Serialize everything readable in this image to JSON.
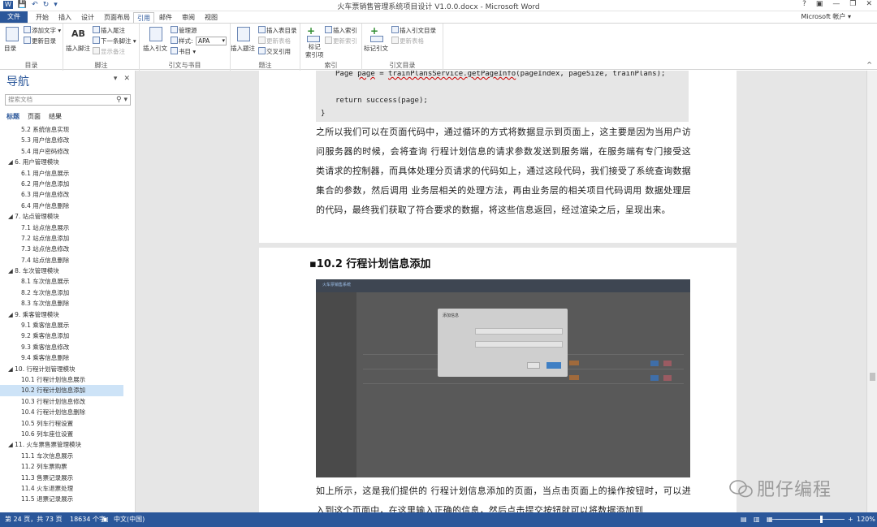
{
  "window": {
    "title": "火车票销售管理系统项目设计 V1.0.0.docx - Microsoft Word",
    "help": "?",
    "account": "Microsoft 帐户"
  },
  "qat": {
    "save": "💾",
    "undo": "↶",
    "redo": "↻",
    "customize": "▾"
  },
  "ribbon_tabs": [
    "开始",
    "插入",
    "设计",
    "页面布局",
    "引用",
    "邮件",
    "审阅",
    "视图"
  ],
  "file_tab": "文件",
  "active_tab": "引用",
  "ribbon": {
    "toc": {
      "big": "目录",
      "add_text": "添加文字",
      "update": "更新目录",
      "group": "目录"
    },
    "footnotes": {
      "insert_footnote": "插入脚注",
      "insert_endnote": "插入尾注",
      "next": "下一条脚注",
      "show": "显示备注",
      "group": "脚注",
      "ab": "AB"
    },
    "citations": {
      "insert": "插入引文",
      "manage": "管理源",
      "style_label": "样式:",
      "style_value": "APA",
      "bib": "书目",
      "group": "引文与书目"
    },
    "captions": {
      "insert_caption": "插入题注",
      "insert_tof": "插入表目录",
      "update_table": "更新表格",
      "cross_ref": "交叉引用",
      "group": "题注"
    },
    "index": {
      "mark": "标记\n索引项",
      "insert_index": "插入索引",
      "update_index": "更新索引",
      "group": "索引"
    },
    "toa": {
      "mark": "标记引文",
      "insert_toa": "插入引文目录",
      "update_table": "更新表格",
      "group": "引文目录"
    }
  },
  "nav": {
    "title": "导航",
    "search_placeholder": "搜索文档",
    "tabs": [
      "标题",
      "页面",
      "结果"
    ],
    "items": [
      {
        "text": "5.2 系统信息实现",
        "level": 2
      },
      {
        "text": "5.3 用户信息修改",
        "level": 2
      },
      {
        "text": "5.4 用户密码修改",
        "level": 2
      },
      {
        "text": "◢ 6. 用户管理模块",
        "level": 1
      },
      {
        "text": "6.1 用户信息展示",
        "level": 2
      },
      {
        "text": "6.2 用户信息添加",
        "level": 2
      },
      {
        "text": "6.3 用户信息修改",
        "level": 2
      },
      {
        "text": "6.4 用户信息删除",
        "level": 2
      },
      {
        "text": "◢ 7. 站点管理模块",
        "level": 1
      },
      {
        "text": "7.1 站点信息展示",
        "level": 2
      },
      {
        "text": "7.2 站点信息添加",
        "level": 2
      },
      {
        "text": "7.3 站点信息修改",
        "level": 2
      },
      {
        "text": "7.4 站点信息删除",
        "level": 2
      },
      {
        "text": "◢ 8. 车次管理模块",
        "level": 1
      },
      {
        "text": "8.1 车次信息展示",
        "level": 2
      },
      {
        "text": "8.2 车次信息添加",
        "level": 2
      },
      {
        "text": "8.3 车次信息删除",
        "level": 2
      },
      {
        "text": "◢ 9. 乘客管理模块",
        "level": 1
      },
      {
        "text": "9.1 乘客信息展示",
        "level": 2
      },
      {
        "text": "9.2 乘客信息添加",
        "level": 2
      },
      {
        "text": "9.3 乘客信息修改",
        "level": 2
      },
      {
        "text": "9.4 乘客信息删除",
        "level": 2
      },
      {
        "text": "◢ 10. 行程计划管理模块",
        "level": 1
      },
      {
        "text": "10.1 行程计划信息展示",
        "level": 2
      },
      {
        "text": "10.2 行程计划信息添加",
        "level": 2,
        "selected": true
      },
      {
        "text": "10.3 行程计划信息修改",
        "level": 2
      },
      {
        "text": "10.4 行程计划信息删除",
        "level": 2
      },
      {
        "text": "10.5 列车行程设置",
        "level": 2
      },
      {
        "text": "10.6 列车座位设置",
        "level": 2
      },
      {
        "text": "◢ 11. 火车票售票管理模块",
        "level": 1
      },
      {
        "text": "11.1 车次信息展示",
        "level": 2
      },
      {
        "text": "11.2 列车票购票",
        "level": 2
      },
      {
        "text": "11.3 售票记录展示",
        "level": 2
      },
      {
        "text": "11.4 火车退票处理",
        "level": 2
      },
      {
        "text": "11.5 退票记录展示",
        "level": 2
      }
    ]
  },
  "doc": {
    "code_line1_pre": "Page ",
    "code_line1_var": "page",
    "code_line1_mid": " = ",
    "code_line1_call": "trainPlansService.getPageInfo",
    "code_line1_args": "(pageIndex, pageSize, trainPlans);",
    "code_line2": "return success(page);",
    "code_line3": "}",
    "para1": "之所以我们可以在页面代码中，通过循环的方式将数据显示到页面上，这主要是因为当用户访问服务器的时候，会将查询  行程计划信息的请求参数发送到服务端，在服务端有专门接受这类请求的控制器，而具体处理分页请求的代码如上，通过这段代码，我们接受了系统查询数据集合的参数，然后调用  业务层相关的处理方法，再由业务层的相关项目代码调用  数据处理层的代码，最终我们获取了符合要求的数据，将这些信息返回，经过渲染之后，呈现出来。",
    "heading": "▪10.2   行程计划信息添加",
    "screenshot_header": "火车票销售系统",
    "screenshot_modal_title": "添加信息",
    "para2": "如上所示，这是我们提供的  行程计划信息添加的页面，当点击页面上的操作按钮时，可以进入到这个页面中，在这里输入正确的信息，然后点击提交按钮就可以将数据添加到"
  },
  "watermark": "肥仔编程",
  "status": {
    "page": "第 24 页，共 73 页",
    "words": "18634 个字",
    "lang": "中文(中国)",
    "zoom": "120%",
    "minus": "−",
    "plus": "+"
  }
}
